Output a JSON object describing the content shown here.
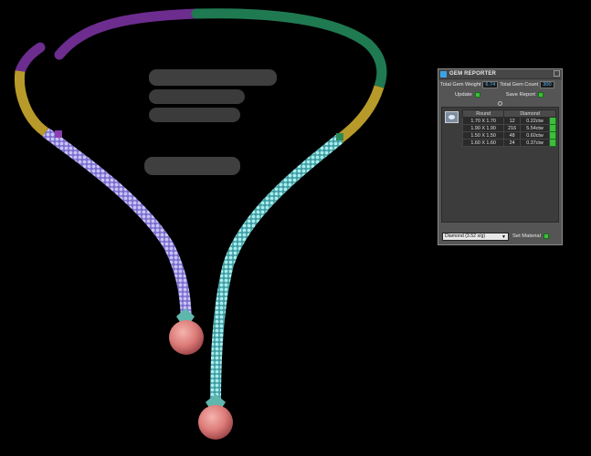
{
  "panel": {
    "title": "GEM REPORTER",
    "total_weight_label": "Total Gem Weight",
    "total_weight_value": "6.74",
    "total_count_label": "Total Gem Count",
    "total_count_value": "300",
    "update_label": "Update",
    "save_report_label": "Save Report",
    "columns": [
      "Round",
      "Diamond"
    ],
    "rows": [
      {
        "size": "1.70 X 1.70",
        "count": "12",
        "weight": "0.22ctw"
      },
      {
        "size": "1.90 X 1.90",
        "count": "216",
        "weight": "5.54ctw"
      },
      {
        "size": "1.50 X 1.50",
        "count": "48",
        "weight": "0.60ctw"
      },
      {
        "size": "1.60 X 1.60",
        "count": "24",
        "weight": "0.37ctw"
      }
    ],
    "material_value": "Diamond   (3.52 s/g)",
    "set_material_label": "Set Material"
  },
  "colors": {
    "purple": "#6c2d8f",
    "green": "#1f7a52",
    "gold": "#b89a2a",
    "lilac_gems": "#a49be8",
    "teal_gems": "#7fd6d6",
    "drop_pink": "#e07f7f",
    "accent_button": "#3bbf3b"
  }
}
